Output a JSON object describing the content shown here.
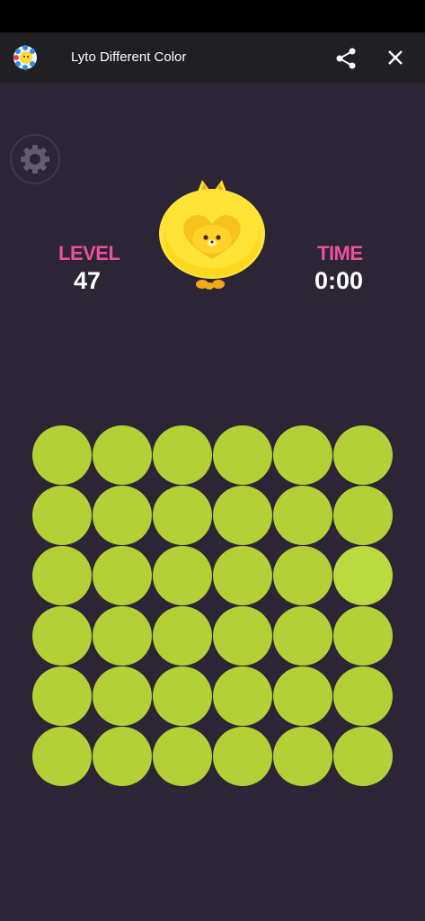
{
  "app": {
    "title": "Lyto Different Color",
    "icons": {
      "app": "lyto-app-icon",
      "share": "share-icon",
      "close": "close-icon",
      "settings": "gear-icon",
      "mascot": "yellow-furry-mascot"
    }
  },
  "hud": {
    "level_label": "LEVEL",
    "level_value": "47",
    "time_label": "TIME",
    "time_value": "0:00"
  },
  "board": {
    "rows": 6,
    "cols": 6,
    "base_color": "#b3d036",
    "odd_color": "#bada3f",
    "odd_cell": {
      "row": 3,
      "col": 6
    }
  },
  "colors": {
    "background": "#2b2536",
    "accent": "#ef4f9f",
    "appbar": "#202024"
  }
}
